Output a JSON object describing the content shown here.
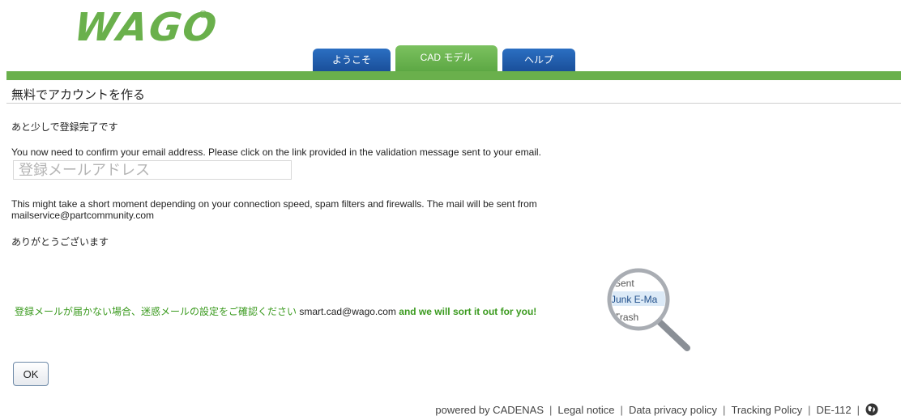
{
  "header": {
    "logo_text": "WAGO",
    "logo_mark": "®",
    "brand_color": "#6ab04c"
  },
  "tabs": [
    {
      "label": "ようこそ",
      "active": false
    },
    {
      "label": "CAD モデル",
      "active": true
    },
    {
      "label": "ヘルプ",
      "active": false
    }
  ],
  "main": {
    "title": "無料でアカウントを作る",
    "almost_done": "あと少しで登録完了です",
    "confirm_message": "You now need to confirm your email address. Please click on the link provided in the validation message sent to your email.",
    "email_placeholder": "登録メールアドレス",
    "delay_message_line1": "This might take a short moment depending on your connection speed, spam filters and firewalls. The mail will be sent from",
    "delay_message_line2": "mailservice@partcommunity.com",
    "thanks": "ありがとうございます",
    "support_prefix": "登録メールが届かない場合、迷惑メールの設定をご確認ください",
    "support_email": "smart.cad@wago.com",
    "support_suffix": "and we will sort it out for you!",
    "magnifier_items": [
      "Sent",
      "Junk E-Ma",
      "Trash"
    ],
    "ok_label": "OK"
  },
  "footer": {
    "powered_by": "powered by CADENAS",
    "legal": "Legal notice",
    "privacy": "Data privacy policy",
    "tracking": "Tracking Policy",
    "server": "DE-112",
    "globe_icon": "globe-icon"
  }
}
